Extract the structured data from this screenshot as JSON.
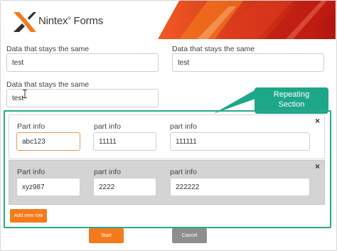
{
  "brand": {
    "name": "Nintex",
    "product": "Forms",
    "trademark": "®"
  },
  "colors": {
    "accent": "#f47a1c",
    "callout": "#1ea689",
    "section_border": "#2ca78c",
    "cancel": "#8e8e8e"
  },
  "top_fields": [
    {
      "label": "Data that stays the same",
      "value": "test"
    },
    {
      "label": "Data that stays the same",
      "value": "test"
    },
    {
      "label": "Data that stays the same",
      "value": "test"
    }
  ],
  "callout": {
    "line1": "Repeating",
    "line2": "Section"
  },
  "repeating_rows": [
    {
      "labels": [
        "Part info",
        "part info",
        "part info"
      ],
      "values": [
        "abc123",
        "11111",
        "111111"
      ],
      "close": "×"
    },
    {
      "labels": [
        "Part info",
        "part info",
        "part info"
      ],
      "values": [
        "xyz987",
        "2222",
        "222222"
      ],
      "close": "×"
    }
  ],
  "buttons": {
    "add_row": "Add new row",
    "start": "Start",
    "cancel": "Cancel"
  },
  "icons": {
    "logo": "nintex-x-logo-icon",
    "text_cursor": "ibeam-cursor-icon",
    "remove_row": "close-icon"
  }
}
